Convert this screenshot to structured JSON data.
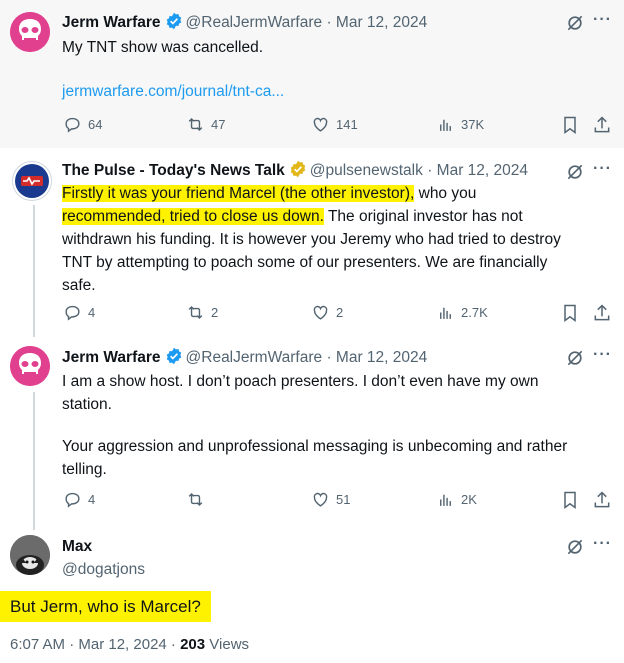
{
  "tweet1": {
    "name": "Jerm Warfare",
    "handle": "@RealJermWarfare",
    "date": "· Mar 12, 2024",
    "text": "My TNT show was cancelled.",
    "link": "jermwarfare.com/journal/tnt-ca...",
    "replies": "64",
    "retweets": "47",
    "likes": "141",
    "views": "37K"
  },
  "tweet2": {
    "name": "The Pulse - Today's News Talk",
    "handle": "@pulsenewstalk",
    "date": "· Mar 12, 2024",
    "line1_hl": "Firstly it was your friend Marcel (the other investor),",
    "line1_rest": " who you",
    "line2_hl": "recommended, tried to close us down.",
    "line2_rest": " The original investor has not",
    "line3": "withdrawn his funding. It is however you Jeremy who had  tried to destroy",
    "line4": "TNT by attempting to poach some of our presenters. We are financially",
    "line5": "safe.",
    "replies": "4",
    "retweets": "2",
    "likes": "2",
    "views": "2.7K"
  },
  "tweet3": {
    "name": "Jerm Warfare",
    "handle": "@RealJermWarfare",
    "date": "· Mar 12, 2024",
    "line1": "I am a show host. I don’t poach presenters. I don’t even have my own",
    "line2": "station.",
    "line3": "Your aggression and unprofessional messaging is unbecoming and rather",
    "line4": "telling.",
    "replies": "4",
    "retweets": "",
    "likes": "51",
    "views": "2K"
  },
  "main_tweet": {
    "name": "Max",
    "handle": "@dogatjons",
    "text": "But Jerm, who is Marcel?",
    "time": "6:07 AM · Mar 12, 2024 · ",
    "views_count": "203",
    "views_label": " Views"
  },
  "colors": {
    "accent": "#1d9bf0",
    "highlight": "#fef200",
    "muted": "#536471",
    "jerm_avatar": "#e0408e"
  }
}
